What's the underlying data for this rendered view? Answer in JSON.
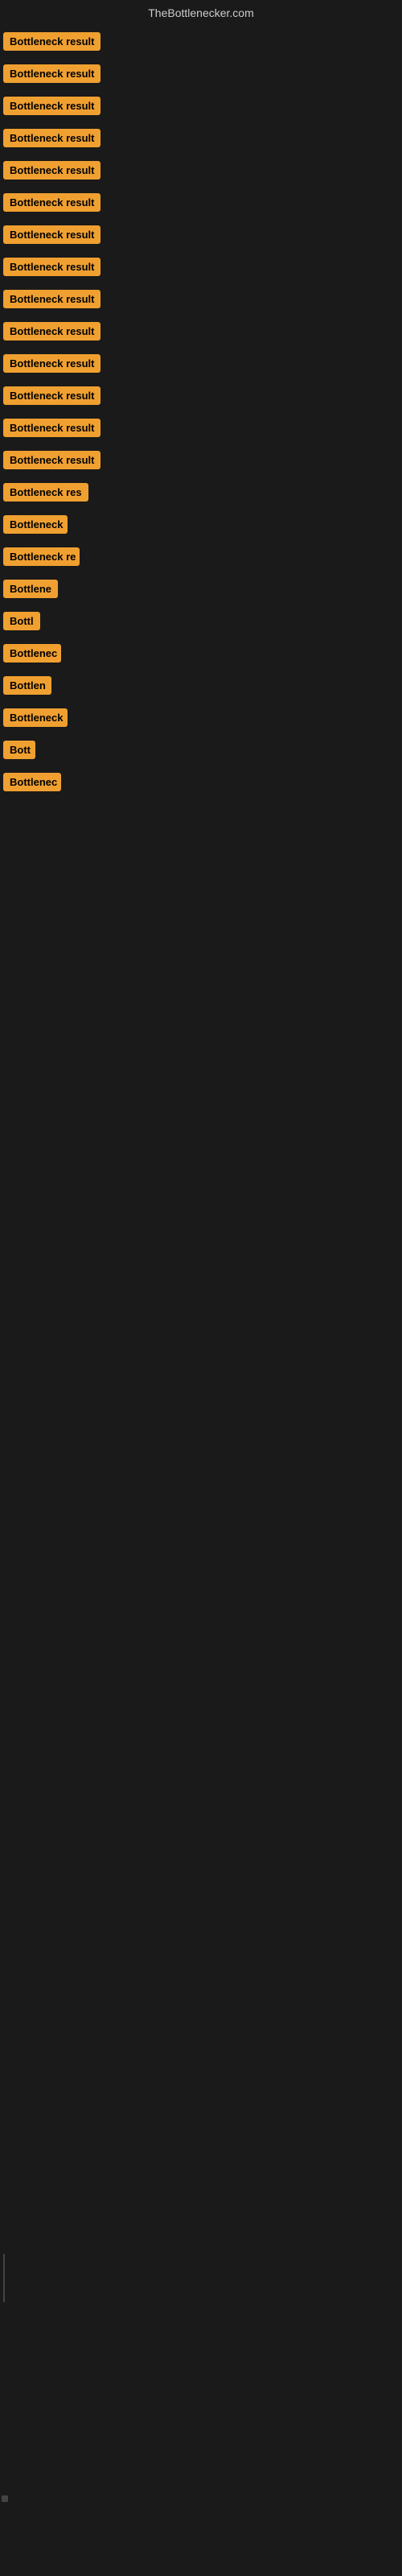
{
  "header": {
    "title": "TheBottlenecker.com"
  },
  "items": [
    {
      "label": "Bottleneck result",
      "width": 130
    },
    {
      "label": "Bottleneck result",
      "width": 130
    },
    {
      "label": "Bottleneck result",
      "width": 130
    },
    {
      "label": "Bottleneck result",
      "width": 130
    },
    {
      "label": "Bottleneck result",
      "width": 130
    },
    {
      "label": "Bottleneck result",
      "width": 130
    },
    {
      "label": "Bottleneck result",
      "width": 130
    },
    {
      "label": "Bottleneck result",
      "width": 130
    },
    {
      "label": "Bottleneck result",
      "width": 130
    },
    {
      "label": "Bottleneck result",
      "width": 130
    },
    {
      "label": "Bottleneck result",
      "width": 130
    },
    {
      "label": "Bottleneck result",
      "width": 130
    },
    {
      "label": "Bottleneck result",
      "width": 130
    },
    {
      "label": "Bottleneck result",
      "width": 130
    },
    {
      "label": "Bottleneck res",
      "width": 112
    },
    {
      "label": "Bottleneck",
      "width": 80
    },
    {
      "label": "Bottleneck re",
      "width": 95
    },
    {
      "label": "Bottlene",
      "width": 68
    },
    {
      "label": "Bottl",
      "width": 46
    },
    {
      "label": "Bottlenec",
      "width": 72
    },
    {
      "label": "Bottlen",
      "width": 60
    },
    {
      "label": "Bottleneck",
      "width": 80
    },
    {
      "label": "Bott",
      "width": 40
    },
    {
      "label": "Bottlenec",
      "width": 72
    }
  ]
}
